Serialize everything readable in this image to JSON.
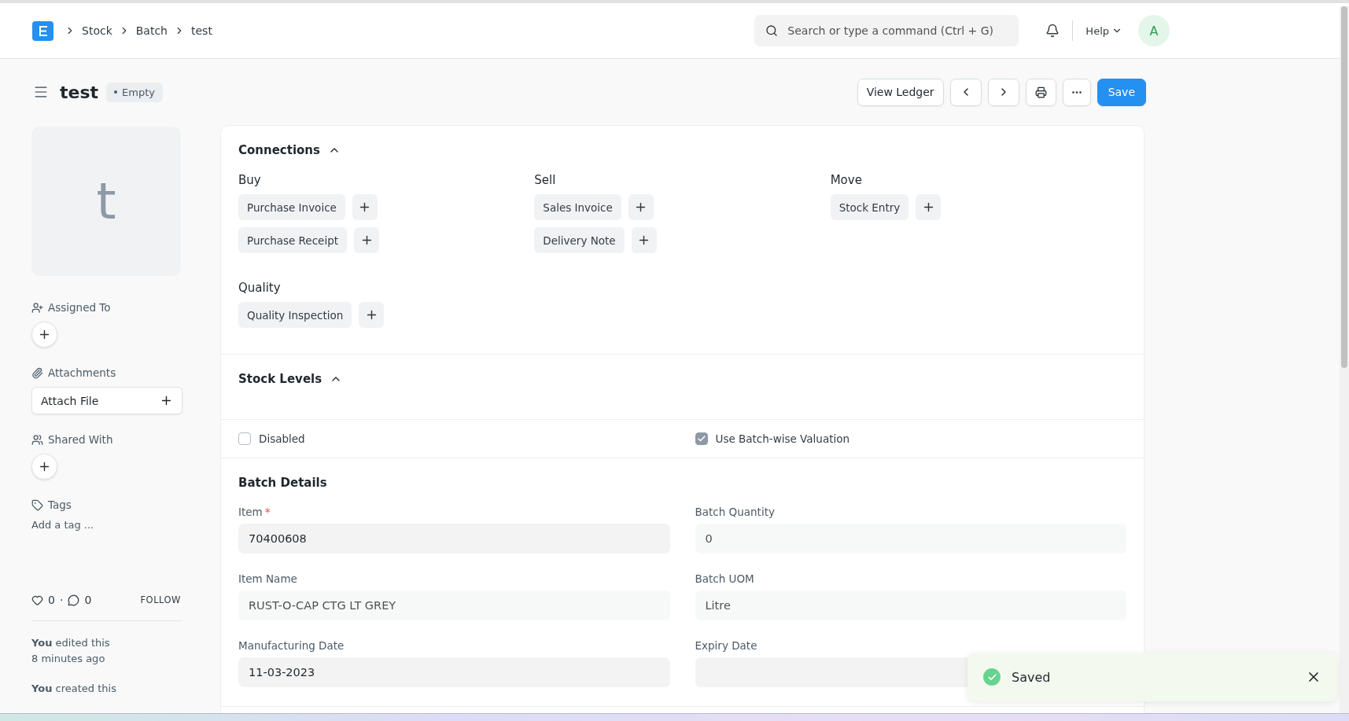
{
  "breadcrumbs": [
    "Stock",
    "Batch",
    "test"
  ],
  "search": {
    "placeholder": "Search or type a command (Ctrl + G)"
  },
  "help": "Help",
  "avatar": "A",
  "title": "test",
  "status": "Empty",
  "actions": [
    "View Ledger"
  ],
  "save": "Save",
  "sidebar": {
    "image_letter": "t",
    "assigned_to": "Assigned To",
    "attachments": "Attachments",
    "attach_file": "Attach File",
    "shared_with": "Shared With",
    "tags": "Tags",
    "add_tag": "Add a tag ...",
    "likes": "0",
    "separator": "·",
    "comments": "0",
    "follow": "FOLLOW",
    "activity": [
      {
        "text": "**You** edited this",
        "time": "8 minutes ago"
      },
      {
        "text": "**You** created this"
      }
    ]
  },
  "connections": {
    "title": "Connections",
    "expanded": true,
    "groups": [
      {
        "title": "Buy",
        "items": [
          "Purchase Invoice",
          "Purchase Receipt"
        ]
      },
      {
        "title": "Sell",
        "items": [
          "Sales Invoice",
          "Delivery Note"
        ]
      },
      {
        "title": "Move",
        "items": [
          "Stock Entry"
        ]
      },
      {
        "title": "Quality",
        "items": [
          "Quality Inspection"
        ]
      }
    ]
  },
  "stock_levels": {
    "title": "Stock Levels",
    "expanded": true
  },
  "checkboxes": [
    {
      "label": "Disabled",
      "checked": false
    },
    {
      "label": "Use Batch-wise Valuation",
      "checked": true
    }
  ],
  "batch_details": {
    "title": "Batch Details",
    "required_mark": "*",
    "fields": [
      {
        "label": "Item",
        "required": true,
        "value": "70400608",
        "read_only": false
      },
      {
        "label": "Batch Quantity",
        "required": false,
        "value": "0",
        "read_only": true
      },
      {
        "label": "Item Name",
        "required": false,
        "value": "RUST-O-CAP CTG LT GREY",
        "read_only": true
      },
      {
        "label": "Batch UOM",
        "required": false,
        "value": "Litre",
        "read_only": true
      },
      {
        "label": "Manufacturing Date",
        "required": false,
        "value": "11-03-2023",
        "read_only": false
      },
      {
        "label": "Expiry Date",
        "required": false,
        "read_only": false
      }
    ]
  },
  "toast": {
    "message": "Saved"
  }
}
